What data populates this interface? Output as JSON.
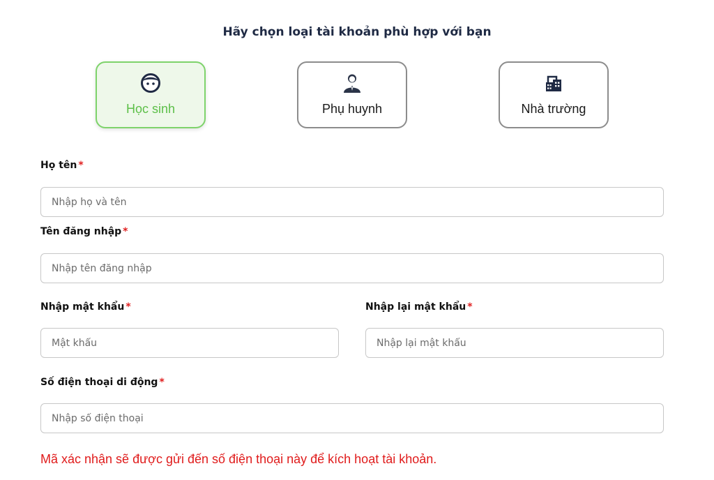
{
  "heading": "Hãy chọn loại tài khoản phù hợp với bạn",
  "account_types": [
    {
      "label": "Học sinh",
      "icon": "student-face-icon",
      "selected": true
    },
    {
      "label": "Phụ huynh",
      "icon": "parent-person-icon",
      "selected": false
    },
    {
      "label": "Nhà trường",
      "icon": "school-building-icon",
      "selected": false
    }
  ],
  "form": {
    "full_name": {
      "label": "Họ tên",
      "placeholder": "Nhập họ và tên"
    },
    "username": {
      "label": "Tên đăng nhập",
      "placeholder": "Nhập tên đăng nhập"
    },
    "password": {
      "label": "Nhập mật khẩu",
      "placeholder": "Mật khẩu"
    },
    "confirm_password": {
      "label": "Nhập lại mật khẩu",
      "placeholder": "Nhập lại mật khẩu"
    },
    "phone": {
      "label": "Số điện thoại di động",
      "placeholder": "Nhập số điện thoại"
    },
    "required_mark": "*"
  },
  "notice": "Mã xác nhận sẽ được gửi đến số điện thoại này để kích hoạt tài khoản.",
  "colors": {
    "selected_border": "#7ed36b",
    "selected_bg": "#eef8ea",
    "selected_text": "#5cbf48",
    "required": "#e02020",
    "notice": "#e01b1b",
    "heading": "#1f2a44"
  }
}
